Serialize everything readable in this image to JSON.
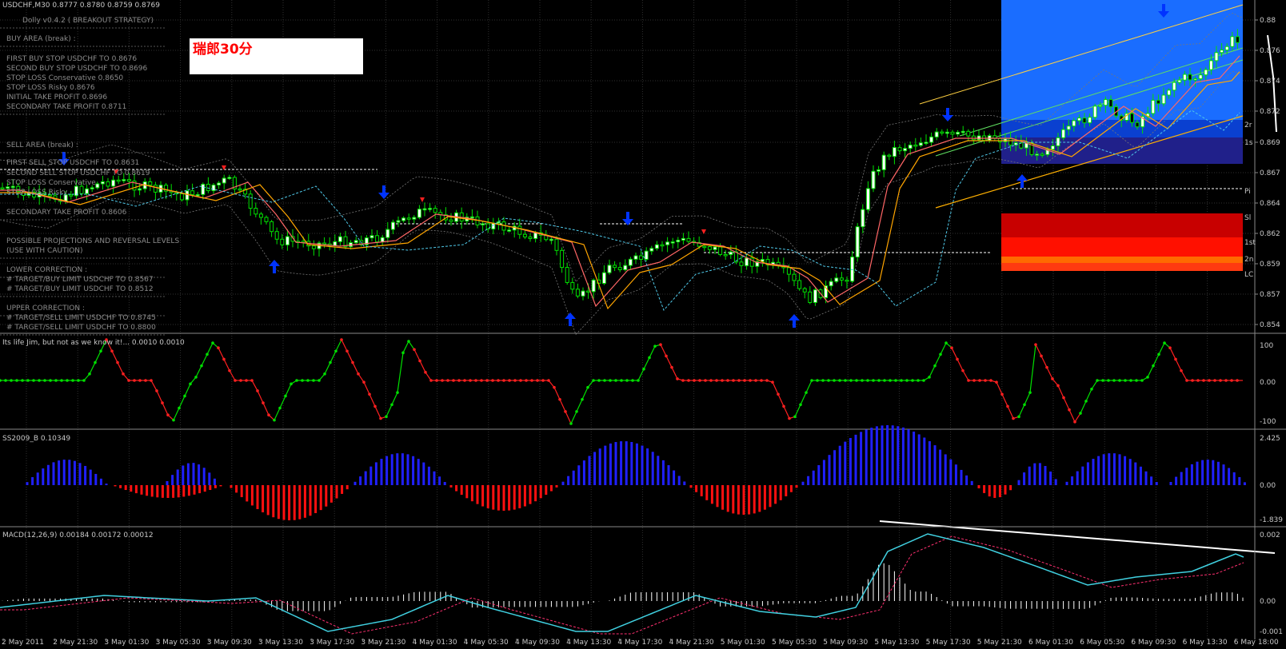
{
  "chart_data": {
    "type": "candlestick",
    "title": "USDCHF,M30  0.8777 0.8780 0.8759 0.8769",
    "panel_labels": {
      "iddd": "Its life Jim, but not as we know it!... 0.0010 0.0010",
      "ss": "SS2009_B 0.10349",
      "macd": "MACD(12,26,9) 0.00184 0.00172 0.00012"
    },
    "price_axis_labels": [
      "0.88",
      "0.876",
      "0.874",
      "0.872",
      "0.869",
      "0.867",
      "0.864",
      "0.862",
      "0.859",
      "0.857",
      "0.854"
    ],
    "iddd_axis_labels": [
      "100",
      "0.00",
      "-100"
    ],
    "ss_axis_labels": [
      "2.425",
      "0.00",
      "-1.839"
    ],
    "macd_axis_labels": [
      "0.002",
      "0.00",
      "-0.001"
    ],
    "time_labels": [
      "2 May 2011",
      "2 May 21:30",
      "3 May 01:30",
      "3 May 05:30",
      "3 May 09:30",
      "3 May 13:30",
      "3 May 17:30",
      "3 May 21:30",
      "4 May 01:30",
      "4 May 05:30",
      "4 May 09:30",
      "4 May 13:30",
      "4 May 17:30",
      "4 May 21:30",
      "5 May 01:30",
      "5 May 05:30",
      "5 May 09:30",
      "5 May 13:30",
      "5 May 17:30",
      "5 May 21:30",
      "6 May 01:30",
      "6 May 05:30",
      "6 May 09:30",
      "6 May 13:30",
      "6 May 18:00"
    ],
    "right_zone_labels": [
      "2r",
      "1s",
      "Pi",
      "Sl",
      "1st",
      "2n",
      "LC"
    ],
    "overlay_text": [
      "Dolly v0.4.2 ( BREAKOUT STRATEGY)",
      "BUY AREA (break) :",
      "FIRST BUY STOP  USDCHF TO 0.8676",
      "SECOND BUY STOP  USDCHF TO 0.8696",
      "STOP LOSS Conservative 0.8650",
      "STOP LOSS Risky 0.8676",
      "INITIAL TAKE PROFIT 0.8696",
      "SECONDARY TAKE PROFIT 0.8711",
      "SELL AREA (break) :",
      "FIRST SELL STOP  USDCHF TO 0.8631",
      "SECOND SELL STOP  USDCHF TO 0.8619",
      "STOP LOSS Conservative",
      "STOP LOSS Risky",
      "SECONDARY TAKE PROFIT 0.8606",
      "POSSIBLE PROJECTIONS AND REVERSAL LEVELS",
      "(USE WITH CAUTION)",
      "LOWER CORRECTION :",
      "# TARGET/BUY LIMIT  USDCHF TO 0.8567",
      "# TARGET/BUY LIMIT  USDCHF TO 0.8512",
      "UPPER CORRECTION :",
      "# TARGET/SELL LIMIT  USDCHF TO 0.8745",
      "# TARGET/SELL LIMIT  USDCHF TO 0.8800"
    ],
    "title_box": "瑞郎30分",
    "colors": {
      "background": "#000000",
      "bull": "#00e000",
      "bear": "#00e000",
      "bull_body": "#ffffff",
      "ma_fast": "#ff6666",
      "ma_slow": "#ffa500",
      "arrow_up": "#0033ff",
      "iddd_green": "#00e000",
      "iddd_red": "#ff2020",
      "ss_blue": "#2020ff",
      "ss_red": "#ff1010",
      "macd_main": "#40d0e0",
      "macd_signal": "#ff3070"
    }
  }
}
